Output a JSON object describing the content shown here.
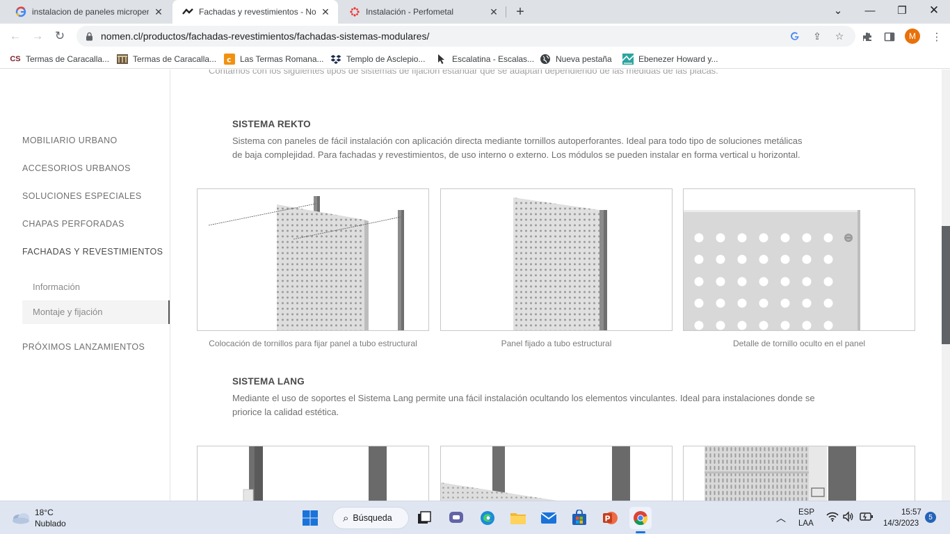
{
  "browser": {
    "tabs": [
      {
        "title": "instalacion de paneles microperfo",
        "active": false
      },
      {
        "title": "Fachadas y revestimientos - Nom",
        "active": true
      },
      {
        "title": "Instalación - Perfometal",
        "active": false
      }
    ],
    "url": "nomen.cl/productos/fachadas-revestimientos/fachadas-sistemas-modulares/",
    "profile_initial": "M",
    "bookmarks": [
      "Termas de Caracalla...",
      "Termas de Caracalla...",
      "Las Termas Romana...",
      "Templo de Asclepio...",
      "Escalatina - Escalas...",
      "Nueva pestaña",
      "Ebenezer Howard y..."
    ],
    "bookmark_cs_label": "CS"
  },
  "sidebar": {
    "items": [
      "MOBILIARIO URBANO",
      "ACCESORIOS URBANOS",
      "SOLUCIONES ESPECIALES",
      "CHAPAS PERFORADAS",
      "FACHADAS Y REVESTIMIENTOS"
    ],
    "sub_items": [
      "Información",
      "Montaje y fijación"
    ],
    "last_item": "PRÓXIMOS LANZAMIENTOS"
  },
  "content": {
    "partial_line": "Contamos con los siguientes tipos de sistemas de fijación estándar que se adaptan dependiendo de las medidas de las placas.",
    "rekto": {
      "title": "SISTEMA REKTO",
      "desc_line1": "Sistema con paneles de fácil instalación con aplicación directa mediante tornillos autoperforantes. Ideal para todo tipo de soluciones metálicas",
      "desc_line2": "de baja complejidad. Para fachadas y revestimientos, de uso interno o externo. Los módulos se pueden instalar en forma vertical u horizontal.",
      "captions": [
        "Colocación de tornillos para fijar panel a tubo estructural",
        "Panel fijado a tubo estructural",
        "Detalle de tornillo oculto en el panel"
      ]
    },
    "lang": {
      "title": "SISTEMA LANG",
      "desc_line1": "Mediante el uso de soportes el Sistema Lang permite una fácil instalación ocultando los elementos vinculantes. Ideal para instalaciones donde se",
      "desc_line2": "priorice la calidad estética."
    }
  },
  "taskbar": {
    "weather_temp": "18°C",
    "weather_desc": "Nublado",
    "search_label": "Búsqueda",
    "lang_top": "ESP",
    "lang_bottom": "LAA",
    "time": "15:57",
    "date": "14/3/2023",
    "notifications": "5"
  },
  "colors": {
    "accent_profile": "#e8710a",
    "panel_gray": "#dcdcdc",
    "post_gray": "#8c8c8c"
  }
}
